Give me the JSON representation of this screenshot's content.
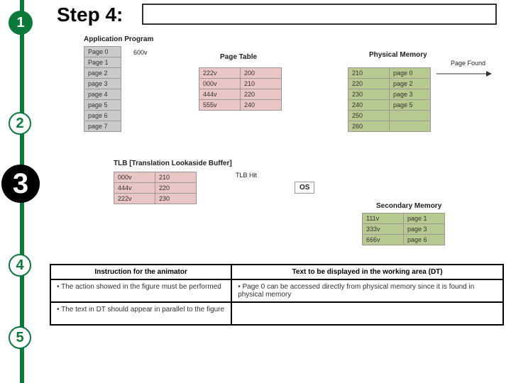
{
  "markers": {
    "m1": "1",
    "m2": "2",
    "m3": "3",
    "m4": "4",
    "m5": "5"
  },
  "title": "Step 4:",
  "labels": {
    "app": "Application Program",
    "pt": "Page Table",
    "pm": "Physical Memory",
    "tlb": "TLB [Translation Lookaside Buffer]",
    "os": "OS",
    "sm": "Secondary Memory",
    "pagefound": "Page Found",
    "tlbhit": "TLB Hit",
    "addr600": "600v"
  },
  "app": [
    "Page 0",
    "Page 1",
    "page 2",
    "page 3",
    "page 4",
    "page 5",
    "page 6",
    "page 7"
  ],
  "pt": [
    [
      "222v",
      "200"
    ],
    [
      "000v",
      "210"
    ],
    [
      "444v",
      "220"
    ],
    [
      "555v",
      "240"
    ]
  ],
  "pm": [
    [
      "210",
      "page 0"
    ],
    [
      "220",
      "page 2"
    ],
    [
      "230",
      "page 3"
    ],
    [
      "240",
      "page 5"
    ],
    [
      "250",
      ""
    ],
    [
      "260",
      ""
    ]
  ],
  "tlb": [
    [
      "000v",
      "210"
    ],
    [
      "444v",
      "220"
    ],
    [
      "222v",
      "230"
    ]
  ],
  "smrows": [
    [
      "111v",
      "page 1"
    ],
    [
      "333v",
      "page 3"
    ],
    [
      "666v",
      "page 6"
    ]
  ],
  "instr": {
    "h1": "Instruction for the animator",
    "h2": "Text to be displayed in the working area (DT)",
    "r1c1": "• The action showed in the figure must be performed",
    "r1c2": "• Page 0 can be accessed directly from physical memory since it is found in physical memory",
    "r2c1": "• The text in DT should appear in parallel to the figure",
    "r2c2": ""
  }
}
